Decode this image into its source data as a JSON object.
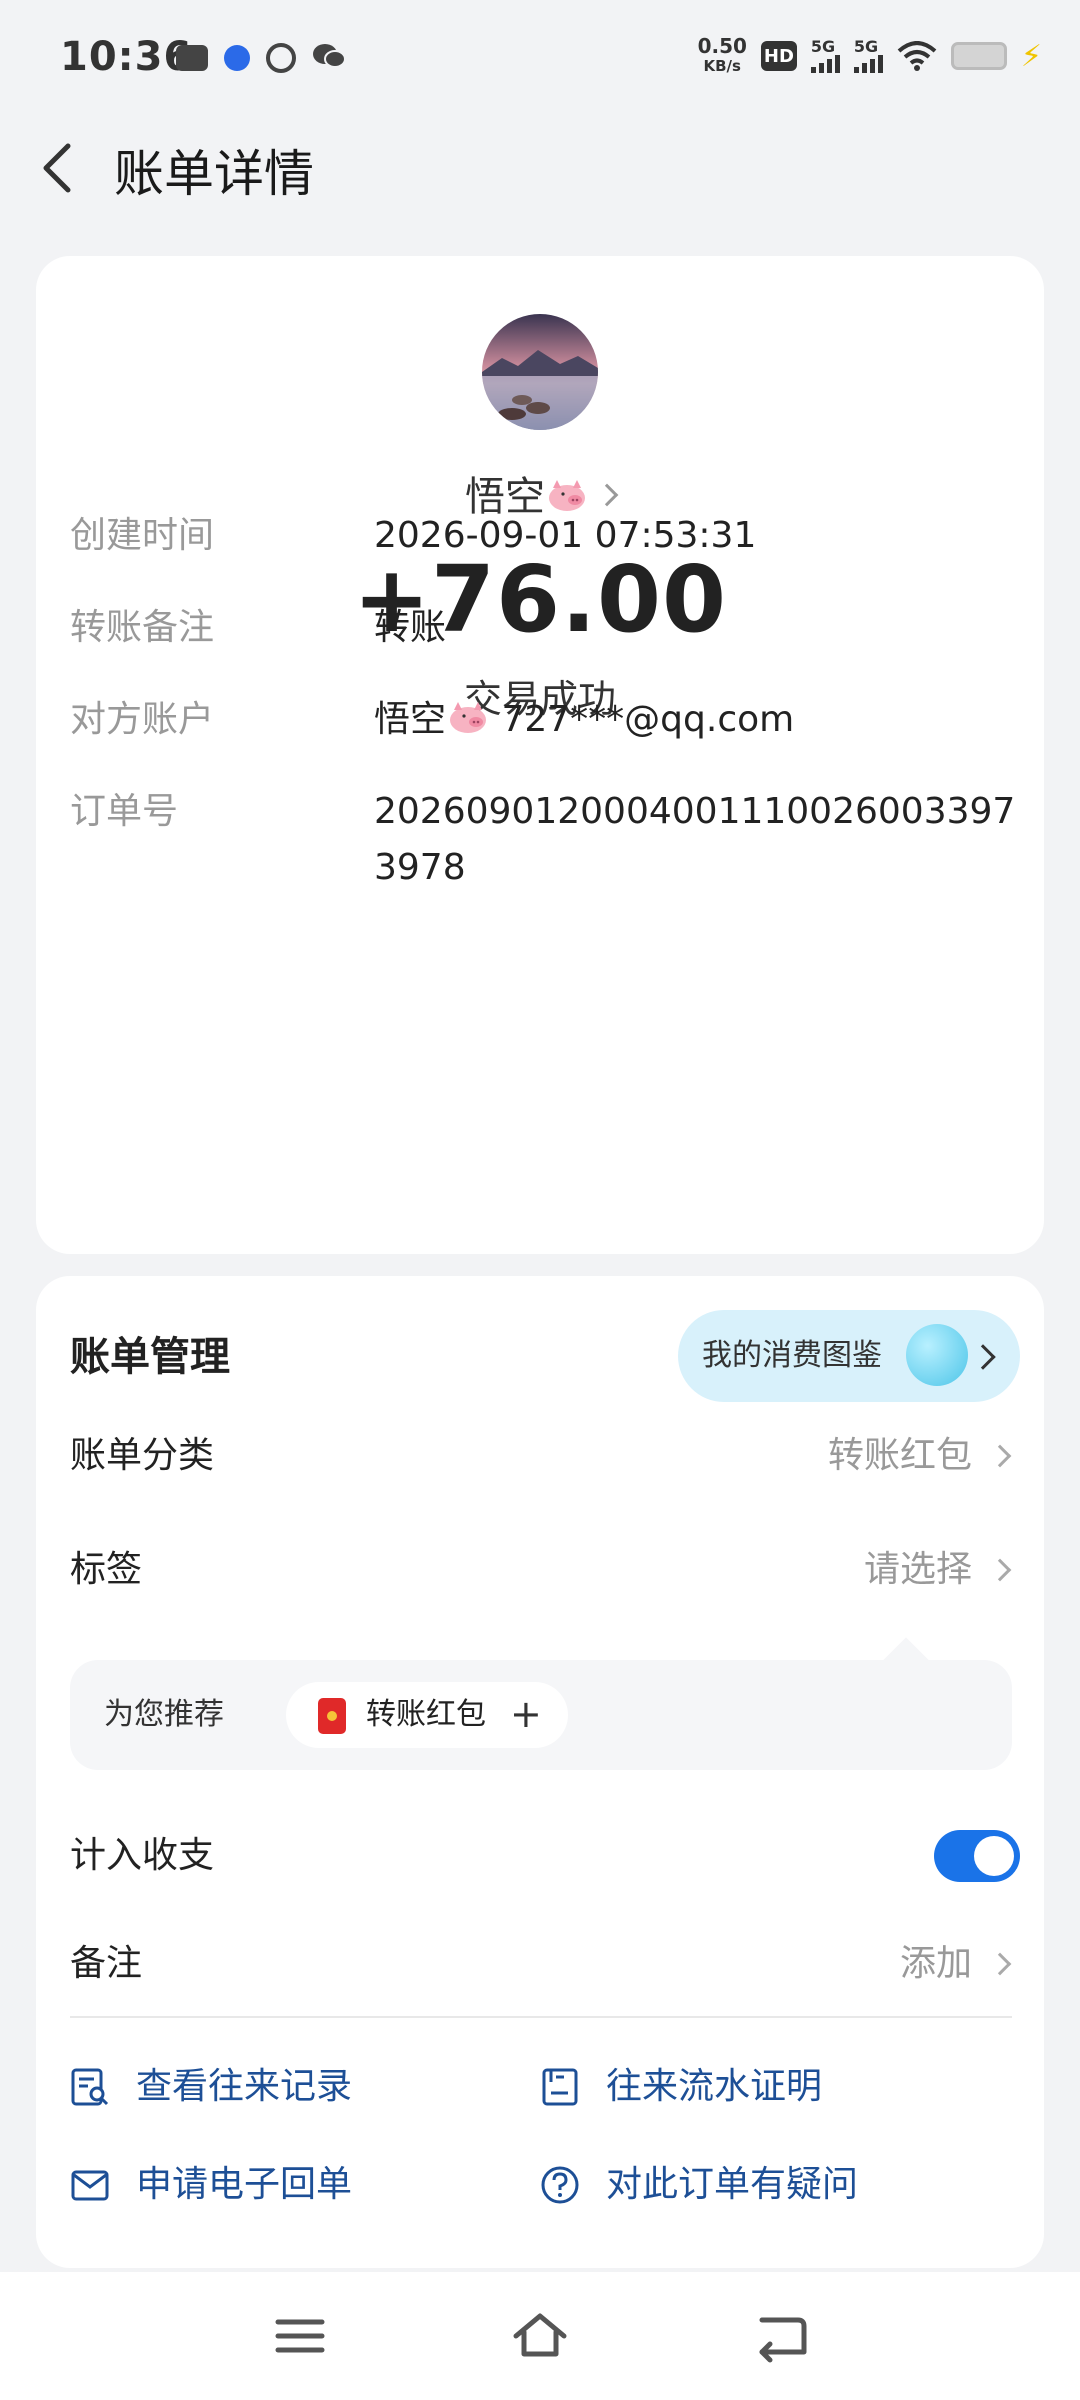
{
  "status_bar": {
    "time": "10:36",
    "net_speed": "0.50",
    "net_speed_unit": "KB/s",
    "hd": "HD",
    "sim1_label": "5G",
    "sim2_label": "5G"
  },
  "header": {
    "title": "账单详情"
  },
  "transaction": {
    "payee_name": "悟空",
    "amount": "+76.00",
    "status": "交易成功"
  },
  "details": [
    {
      "label": "创建时间",
      "value": "2026-09-01 07:53:31"
    },
    {
      "label": "转账备注",
      "value": "转账"
    },
    {
      "label": "对方账户",
      "value_prefix": "悟空",
      "value": " 727***@qq.com"
    },
    {
      "label": "订单号",
      "value": "20260901200040011100260033973978"
    }
  ],
  "management": {
    "title": "账单管理",
    "atlas_label": "我的消费图鉴",
    "category_label": "账单分类",
    "category_value": "转账红包",
    "tag_label": "标签",
    "tag_value": "请选择",
    "recommend_label": "为您推荐",
    "recommend_chip": "转账红包",
    "include_label": "计入收支",
    "include_on": true,
    "note_label": "备注",
    "note_value": "添加"
  },
  "actions": {
    "history": "查看往来记录",
    "statement": "往来流水证明",
    "receipt": "申请电子回单",
    "question": "对此订单有疑问"
  },
  "colors": {
    "accent": "#1a73e8",
    "link": "#1d4f96",
    "background": "#f2f3f5"
  }
}
